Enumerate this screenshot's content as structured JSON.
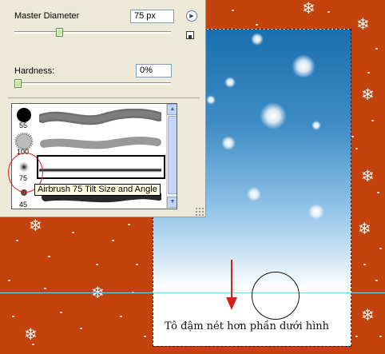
{
  "panel": {
    "master_diameter_label": "Master Diameter",
    "master_diameter_value": "75 px",
    "master_diameter_slider": 0.28,
    "hardness_label": "Hardness:",
    "hardness_value": "0%",
    "hardness_slider": 0.0
  },
  "brushes": [
    {
      "size": "55",
      "stroke_type": "hard-round"
    },
    {
      "size": "100",
      "stroke_type": "chalk"
    },
    {
      "size": "75",
      "stroke_type": "airbrush",
      "selected": true
    },
    {
      "size": "45",
      "stroke_type": "airbrush"
    }
  ],
  "tooltip": "Airbrush 75 Tilt Size and Angle",
  "annotation": {
    "caption": "Tô đậm nét hơn phần dưới hình"
  },
  "colors": {
    "background": "#c4420e",
    "sky_top": "#1a6fae",
    "annotation_red": "#d6201b",
    "guide": "#7fd6e8"
  },
  "icons": {
    "menu_arrow": "panel-menu-arrow-icon",
    "new_preset": "new-brush-preset-icon",
    "scroll_up": "scroll-up-arrow-icon",
    "scroll_down": "scroll-down-arrow-icon"
  }
}
